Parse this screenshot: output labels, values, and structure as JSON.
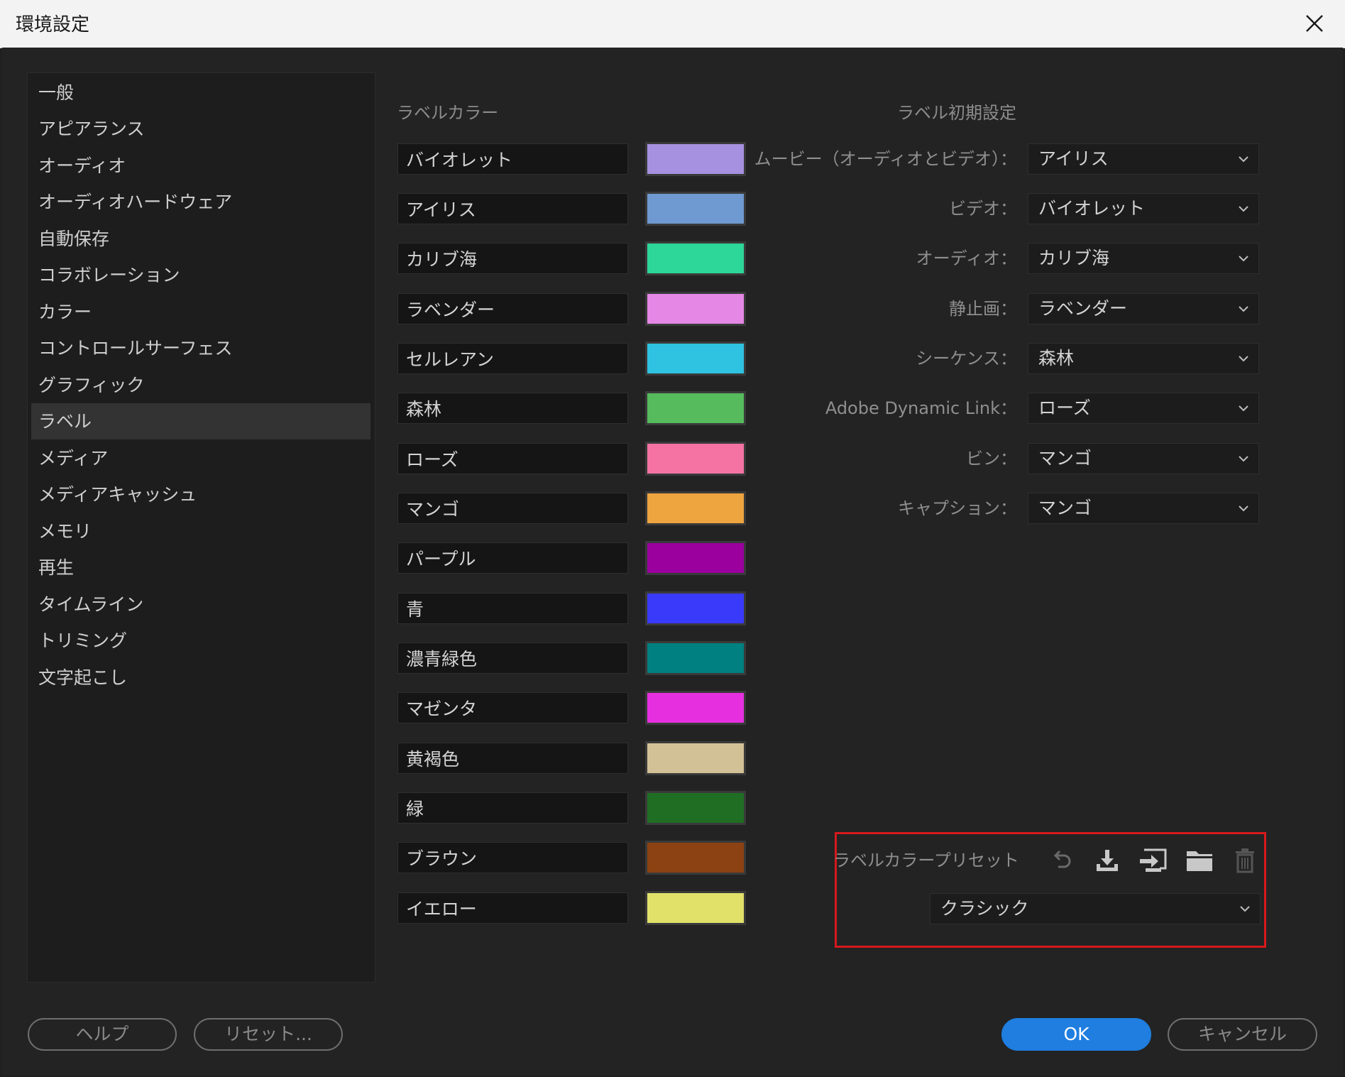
{
  "window": {
    "title": "環境設定"
  },
  "sidebar": {
    "items": [
      {
        "label": "一般"
      },
      {
        "label": "アピアランス"
      },
      {
        "label": "オーディオ"
      },
      {
        "label": "オーディオハードウェア"
      },
      {
        "label": "自動保存"
      },
      {
        "label": "コラボレーション"
      },
      {
        "label": "カラー"
      },
      {
        "label": "コントロールサーフェス"
      },
      {
        "label": "グラフィック"
      },
      {
        "label": "ラベル",
        "selected": true
      },
      {
        "label": "メディア"
      },
      {
        "label": "メディアキャッシュ"
      },
      {
        "label": "メモリ"
      },
      {
        "label": "再生"
      },
      {
        "label": "タイムライン"
      },
      {
        "label": "トリミング"
      },
      {
        "label": "文字起こし"
      }
    ]
  },
  "label_colors": {
    "heading": "ラベルカラー",
    "items": [
      {
        "name": "バイオレット",
        "color": "#a591e0"
      },
      {
        "name": "アイリス",
        "color": "#6f9ad1"
      },
      {
        "name": "カリブ海",
        "color": "#2dd699"
      },
      {
        "name": "ラベンダー",
        "color": "#e587e4"
      },
      {
        "name": "セルレアン",
        "color": "#2fc2e1"
      },
      {
        "name": "森林",
        "color": "#55bb5c"
      },
      {
        "name": "ローズ",
        "color": "#f573a3"
      },
      {
        "name": "マンゴ",
        "color": "#eea43f"
      },
      {
        "name": "パープル",
        "color": "#9b009e"
      },
      {
        "name": "青",
        "color": "#3a3afa"
      },
      {
        "name": "濃青緑色",
        "color": "#008080"
      },
      {
        "name": "マゼンタ",
        "color": "#e630e0"
      },
      {
        "name": "黄褐色",
        "color": "#d2c196"
      },
      {
        "name": "緑",
        "color": "#1f6e24"
      },
      {
        "name": "ブラウン",
        "color": "#8c4212"
      },
      {
        "name": "イエロー",
        "color": "#e1e16a"
      }
    ]
  },
  "label_defaults": {
    "heading": "ラベル初期設定",
    "rows": [
      {
        "label": "ムービー（オーディオとビデオ）：",
        "value": "アイリス"
      },
      {
        "label": "ビデオ：",
        "value": "バイオレット"
      },
      {
        "label": "オーディオ：",
        "value": "カリブ海"
      },
      {
        "label": "静止画：",
        "value": "ラベンダー"
      },
      {
        "label": "シーケンス：",
        "value": "森林"
      },
      {
        "label": "Adobe Dynamic Link：",
        "value": "ローズ"
      },
      {
        "label": "ビン：",
        "value": "マンゴ"
      },
      {
        "label": "キャプション：",
        "value": "マンゴ"
      }
    ]
  },
  "preset": {
    "label": "ラベルカラープリセット",
    "value": "クラシック",
    "icons": [
      "undo-icon",
      "download-icon",
      "import-icon",
      "folder-icon",
      "trash-icon"
    ],
    "highlight_color": "#d6191c"
  },
  "footer": {
    "help": "ヘルプ",
    "reset": "リセット...",
    "ok": "OK",
    "cancel": "キャンセル"
  }
}
